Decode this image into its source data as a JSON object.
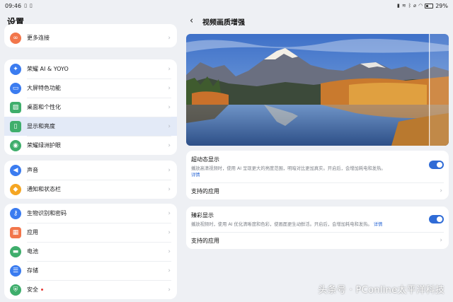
{
  "status_bar": {
    "time": "09:46",
    "left_icons": [
      "sim-icon",
      "sim-icon"
    ],
    "right_icons": [
      "signal-icon",
      "vibrate-icon",
      "bluetooth-icon",
      "mute-icon",
      "wifi-icon",
      "battery-icon"
    ],
    "battery": "29%"
  },
  "left": {
    "title": "设置",
    "groups": [
      {
        "items": [
          {
            "label": "更多连接",
            "icon": "link-icon",
            "color": "#f2764b"
          }
        ]
      },
      {
        "items": [
          {
            "label": "荣耀 AI & YOYO",
            "icon": "ai-sparkle-icon",
            "color": "#3b7cf0"
          },
          {
            "label": "大屏特色功能",
            "icon": "tablet-icon",
            "color": "#3b7cf0"
          },
          {
            "label": "桌面和个性化",
            "icon": "image-icon",
            "color": "#3fae6c"
          },
          {
            "label": "显示和亮度",
            "icon": "phone-display-icon",
            "color": "#3fae6c",
            "active": true
          },
          {
            "label": "荣耀绿洲护眼",
            "icon": "eye-care-icon",
            "color": "#3fae6c"
          }
        ]
      },
      {
        "items": [
          {
            "label": "声音",
            "icon": "speaker-icon",
            "color": "#3b7cf0"
          },
          {
            "label": "通知和状态栏",
            "icon": "bell-icon",
            "color": "#f5a623"
          }
        ]
      },
      {
        "items": [
          {
            "label": "生物识别和密码",
            "icon": "key-icon",
            "color": "#3b7cf0"
          },
          {
            "label": "应用",
            "icon": "apps-grid-icon",
            "color": "#f2764b"
          },
          {
            "label": "电池",
            "icon": "battery-icon",
            "color": "#3fae6c"
          },
          {
            "label": "存储",
            "icon": "storage-icon",
            "color": "#3b7cf0"
          },
          {
            "label": "安全",
            "icon": "shield-icon",
            "color": "#3fae6c",
            "badge": true
          }
        ]
      }
    ]
  },
  "right": {
    "title": "视频画质增强",
    "sections": [
      {
        "title": "超动态显示",
        "desc": "播放高清视频时，使用 AI 呈现更大的亮度范围，明暗对比更加真实。开启后，会增加耗电和发热。",
        "link": "详情",
        "toggle_on": true,
        "sub": "支持的应用"
      },
      {
        "title": "臻彩显示",
        "desc": "播放视频时，使用 AI 优化清晰度和色彩，使画面更生动鲜活。开启后，会增加耗电和发热。",
        "link": "详情",
        "toggle_on": true,
        "sub": "支持的应用"
      }
    ]
  },
  "watermark": "头条号 · PConline太平洋科技",
  "colors": {
    "accent": "#2f6bd6",
    "active_bg": "#e3eaf7",
    "page_bg": "#eef0f4"
  }
}
